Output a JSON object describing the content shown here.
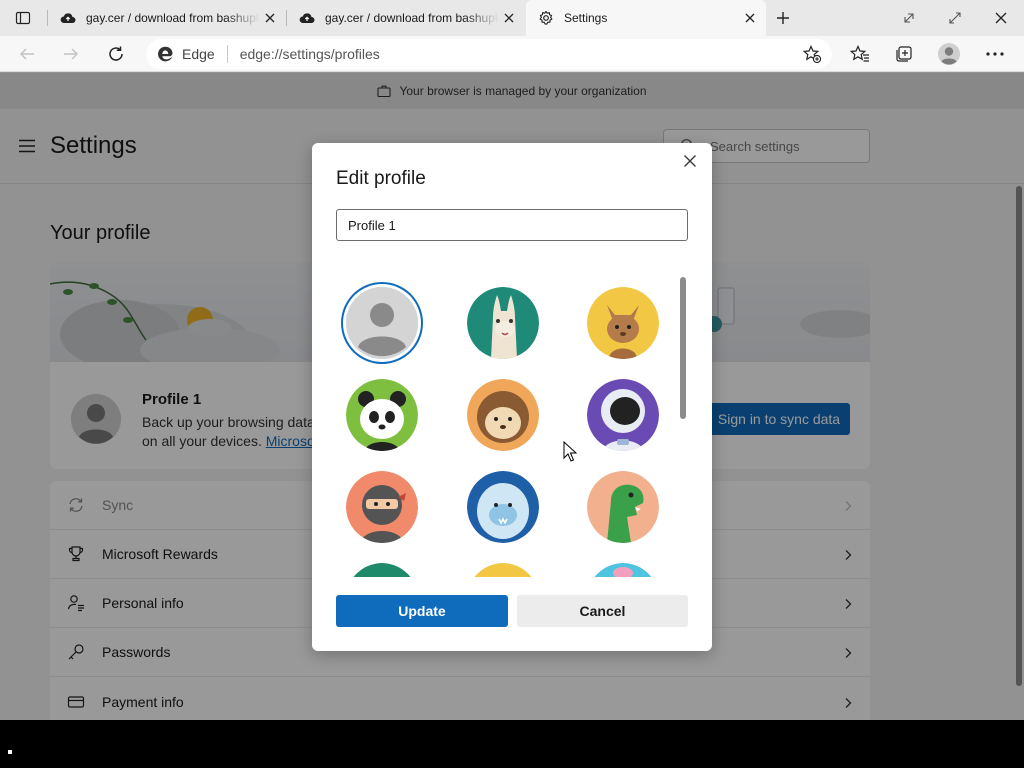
{
  "tabs": [
    {
      "title": "gay.cer / download from bashupload",
      "icon": "upload-cloud-icon",
      "active": false
    },
    {
      "title": "gay.cer / download from bashupload",
      "icon": "upload-cloud-icon",
      "active": false
    },
    {
      "title": "Settings",
      "icon": "gear-icon",
      "active": true
    }
  ],
  "toolbar": {
    "browser_label": "Edge",
    "url": "edge://settings/profiles"
  },
  "managed_banner": "Your browser is managed by your organization",
  "settings": {
    "title": "Settings",
    "search_placeholder": "Search settings",
    "section_title": "Your profile",
    "profile_name": "Profile 1",
    "profile_desc_line1": "Back up your browsing data and see your favorites, passwords, and more",
    "profile_desc_line2": "on all your devices.",
    "profile_link": "Microsoft Privacy Statement",
    "sync_button": "Sign in to sync data",
    "rows": [
      {
        "label": "Sync",
        "icon": "sync-icon",
        "disabled": true
      },
      {
        "label": "Microsoft Rewards",
        "icon": "trophy-icon",
        "disabled": false
      },
      {
        "label": "Personal info",
        "icon": "personal-info-icon",
        "disabled": false
      },
      {
        "label": "Passwords",
        "icon": "key-icon",
        "disabled": false
      },
      {
        "label": "Payment info",
        "icon": "credit-card-icon",
        "disabled": false
      }
    ]
  },
  "dialog": {
    "title": "Edit profile",
    "name_value": "Profile 1",
    "avatars": [
      "default-person",
      "llama",
      "cat",
      "panda",
      "hedgehog",
      "astronaut",
      "ninja",
      "yeti",
      "dinosaur"
    ],
    "selected_avatar": "default-person",
    "update_label": "Update",
    "cancel_label": "Cancel"
  },
  "colors": {
    "accent": "#0f6cbd",
    "overlay": "rgba(0,0,0,0.40)"
  }
}
